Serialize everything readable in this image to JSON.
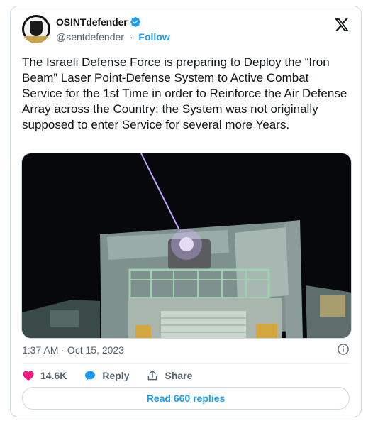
{
  "author": {
    "display_name": "OSINTdefender",
    "handle": "@sentdefender",
    "separator": "·",
    "follow_label": "Follow",
    "verified": true
  },
  "tweet": {
    "text": "The Israeli Defense Force is preparing to Deploy the “Iron Beam” Laser Point-Defense System to Active Combat Service for the 1st Time in order to Reinforce the Air Defense Array across the Country; the System was not originally supposed to enter Service for several more Years.",
    "timestamp": "1:37 AM · Oct 15, 2023"
  },
  "actions": {
    "like_count": "14.6K",
    "reply_label": "Reply",
    "share_label": "Share"
  },
  "read_replies_label": "Read 660 replies",
  "colors": {
    "accent": "#1d9bf0",
    "like": "#f91880",
    "text": "#0f1419",
    "muted": "#536471",
    "border": "#cfd9de"
  },
  "icons": [
    "verified-badge-icon",
    "x-logo-icon",
    "info-icon",
    "heart-icon",
    "reply-bubble-icon",
    "share-icon"
  ]
}
